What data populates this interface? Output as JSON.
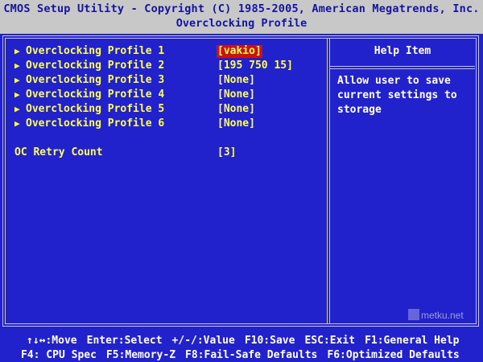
{
  "header": {
    "title": "CMOS Setup Utility - Copyright (C) 1985-2005, American Megatrends, Inc.",
    "subtitle": "Overclocking Profile"
  },
  "menu": {
    "items": [
      {
        "label": "Overclocking Profile 1",
        "value": "[vakio]",
        "submenu": true,
        "selected": true
      },
      {
        "label": "Overclocking Profile 2",
        "value": "[195 750 15]",
        "submenu": true,
        "selected": false
      },
      {
        "label": "Overclocking Profile 3",
        "value": "[None]",
        "submenu": true,
        "selected": false
      },
      {
        "label": "Overclocking Profile 4",
        "value": "[None]",
        "submenu": true,
        "selected": false
      },
      {
        "label": "Overclocking Profile 5",
        "value": "[None]",
        "submenu": true,
        "selected": false
      },
      {
        "label": "Overclocking Profile 6",
        "value": "[None]",
        "submenu": true,
        "selected": false
      },
      {
        "label": "OC Retry Count",
        "value": "[3]",
        "submenu": false,
        "selected": false
      }
    ]
  },
  "help": {
    "title": "Help Item",
    "text": "Allow user to save\ncurrent settings to\nstorage"
  },
  "watermark": {
    "text": "metku.net"
  },
  "footer": {
    "line1": [
      "↑↓↔:Move",
      "Enter:Select",
      "+/-/:Value",
      "F10:Save",
      "ESC:Exit",
      "F1:General Help"
    ],
    "line2": [
      "F4: CPU Spec",
      "F5:Memory-Z",
      "F8:Fail-Safe Defaults",
      "F6:Optimized Defaults"
    ]
  },
  "colors": {
    "background": "#2222cc",
    "header_bg": "#c8c8c8",
    "header_text": "#1414a0",
    "item_text": "#ffff55",
    "selected_bg": "#cc1111",
    "help_text": "#ffffff"
  }
}
